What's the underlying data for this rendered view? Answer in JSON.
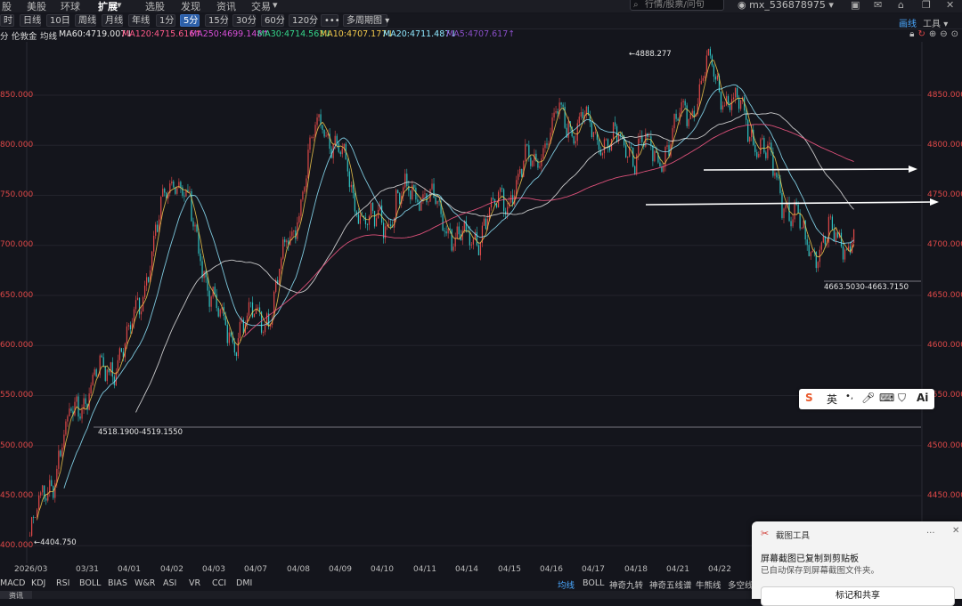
{
  "topnav": {
    "items": [
      "股",
      "美股",
      "环球",
      "扩展",
      "选股",
      "发现",
      "资讯",
      "交易"
    ],
    "active_index": 3,
    "search_placeholder": "行情/股票/问句",
    "user": "mx_536878975",
    "right_buttons": [
      "画线",
      "工具"
    ]
  },
  "periods": [
    "时",
    "日线",
    "10日",
    "周线",
    "月线",
    "年线",
    "1分",
    "5分",
    "15分",
    "30分",
    "60分",
    "120分",
    "•••",
    "多周期图"
  ],
  "active_period": "5分",
  "ma_bar": {
    "prefix": [
      "分",
      "伦敦金",
      "均线"
    ],
    "items": [
      {
        "label": "MA60:4719.007↓",
        "color": "#e8e8e8"
      },
      {
        "label": "MA120:4715.616↑",
        "color": "#ff5a8a"
      },
      {
        "label": "MA250:4699.148↑",
        "color": "#d84fd8"
      },
      {
        "label": "MA30:4714.563↓",
        "color": "#35d48a"
      },
      {
        "label": "MA10:4707.177↓",
        "color": "#f2c94c"
      },
      {
        "label": "MA20:4711.487↓",
        "color": "#8fe8ff"
      },
      {
        "label": "MA5:4707.617↑",
        "color": "#8a4fc8"
      }
    ]
  },
  "y_left_labels": [
    "850.000",
    "800.000",
    "750.000",
    "700.000",
    "650.000",
    "600.000",
    "550.000",
    "500.000",
    "450.000",
    "400.000"
  ],
  "y_right_labels": [
    "4850.000",
    "4800.000",
    "4750.000",
    "4700.000",
    "4650.000",
    "4600.000",
    "4550.000",
    "4500.000",
    "4450.000"
  ],
  "x_labels": [
    "2026/03",
    "03/31",
    "04/01",
    "04/02",
    "04/03",
    "04/07",
    "04/08",
    "04/09",
    "04/10",
    "04/11",
    "04/14",
    "04/15",
    "04/16",
    "04/17",
    "04/18",
    "04/21",
    "04/22"
  ],
  "annotations": {
    "high": "4888.277",
    "low": "4404.750",
    "range1": "4518.1900-4519.1550",
    "range2": "4663.5030-4663.7150"
  },
  "indicators": [
    "MACD",
    "KDJ",
    "RSI",
    "BOLL",
    "BIAS",
    "W&R",
    "ASI",
    "VR",
    "CCI",
    "DMI"
  ],
  "overlays": [
    "均线",
    "BOLL",
    "神奇九转",
    "神奇五线谱",
    "牛熊线",
    "多空线"
  ],
  "bottom_tab": "资讯",
  "ime": {
    "logo": "S",
    "lang": "英"
  },
  "toast": {
    "app": "截图工具",
    "more": "...",
    "close": "✕",
    "title": "屏幕截图已复制到剪贴板",
    "subtitle": "已自动保存到屏幕截图文件夹。",
    "button": "标记和共享"
  },
  "colors": {
    "up": "#e04848",
    "down": "#2fc4c4",
    "bg": "#14151c",
    "axis": "#e04848"
  },
  "chart_data": {
    "type": "line",
    "title": "伦敦金 5分",
    "x": [
      "2026/03",
      "03/31",
      "04/01",
      "04/02",
      "04/03",
      "04/07",
      "04/08",
      "04/09",
      "04/10",
      "04/11",
      "04/14",
      "04/15",
      "04/16",
      "04/17",
      "04/18",
      "04/21",
      "04/22",
      "04/22+"
    ],
    "series": [
      {
        "name": "price",
        "values": [
          4410,
          4545,
          4600,
          4780,
          4610,
          4640,
          4830,
          4715,
          4760,
          4700,
          4760,
          4830,
          4805,
          4790,
          4875,
          4810,
          4700,
          4710
        ]
      }
    ],
    "ylim": [
      4400,
      4900
    ],
    "high": 4888.277,
    "low": 4404.75
  }
}
